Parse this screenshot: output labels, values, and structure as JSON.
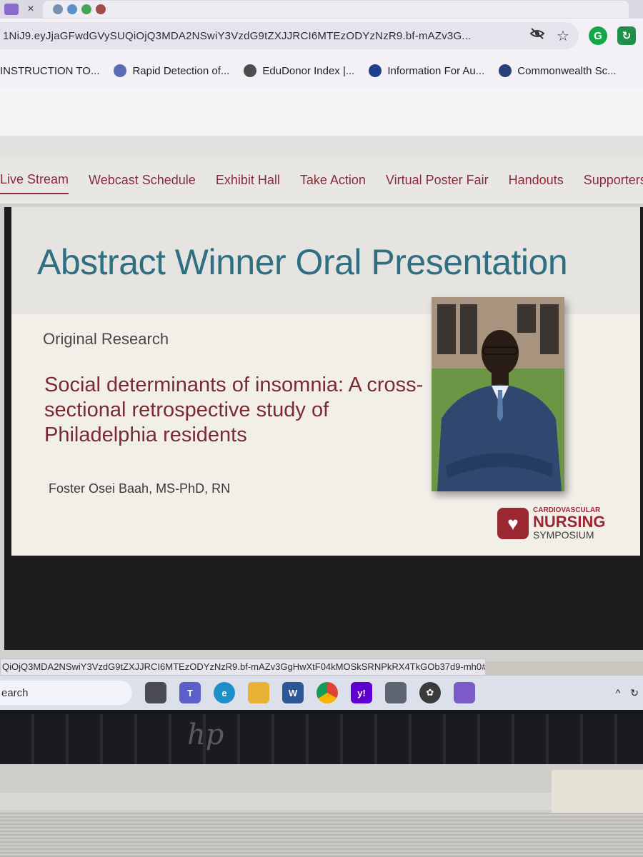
{
  "browser": {
    "url": "1NiJ9.eyJjaGFwdGVySUQiOjQ3MDA2NSwiY3VzdG9tZXJJRCI6MTEzODYzNzR9.bf-mAZv3G...",
    "bookmarks": [
      {
        "label": "INSTRUCTION TO...",
        "color": "#2f2f2f"
      },
      {
        "label": "Rapid Detection of...",
        "color": "#4a5aa8"
      },
      {
        "label": "EduDonor Index |...",
        "color": "#444444"
      },
      {
        "label": "Information For Au...",
        "color": "#1d3f8c"
      },
      {
        "label": "Commonwealth Sc...",
        "color": "#2a3f7a"
      }
    ]
  },
  "site_nav": {
    "items": [
      "Live Stream",
      "Webcast Schedule",
      "Exhibit Hall",
      "Take Action",
      "Virtual Poster Fair",
      "Handouts",
      "Supporters"
    ],
    "active": "Live Stream"
  },
  "slide": {
    "title": "Abstract Winner Oral Presentation",
    "label": "Original Research",
    "study_title": "Social determinants of insomnia: A cross-sectional retrospective study of Philadelphia residents",
    "author": "Foster Osei Baah, MS-PhD, RN",
    "logo": {
      "line1": "CARDIOVASCULAR",
      "line2": "NURSING",
      "line3": "SYMPOSIUM"
    }
  },
  "status_url": "QiOjQ3MDA2NSwiY3VzdG9tZXJJRCI6MTEzODYzNzR9.bf-mAZv3GgHwXtF04kMOSkSRNPkRX4TkGOb37d9-mh0#",
  "taskbar": {
    "search_label": "earch",
    "apps": [
      "teams",
      "edge",
      "file-explorer",
      "word",
      "chrome",
      "yahoo",
      "app-7",
      "app-8",
      "app-9"
    ]
  }
}
